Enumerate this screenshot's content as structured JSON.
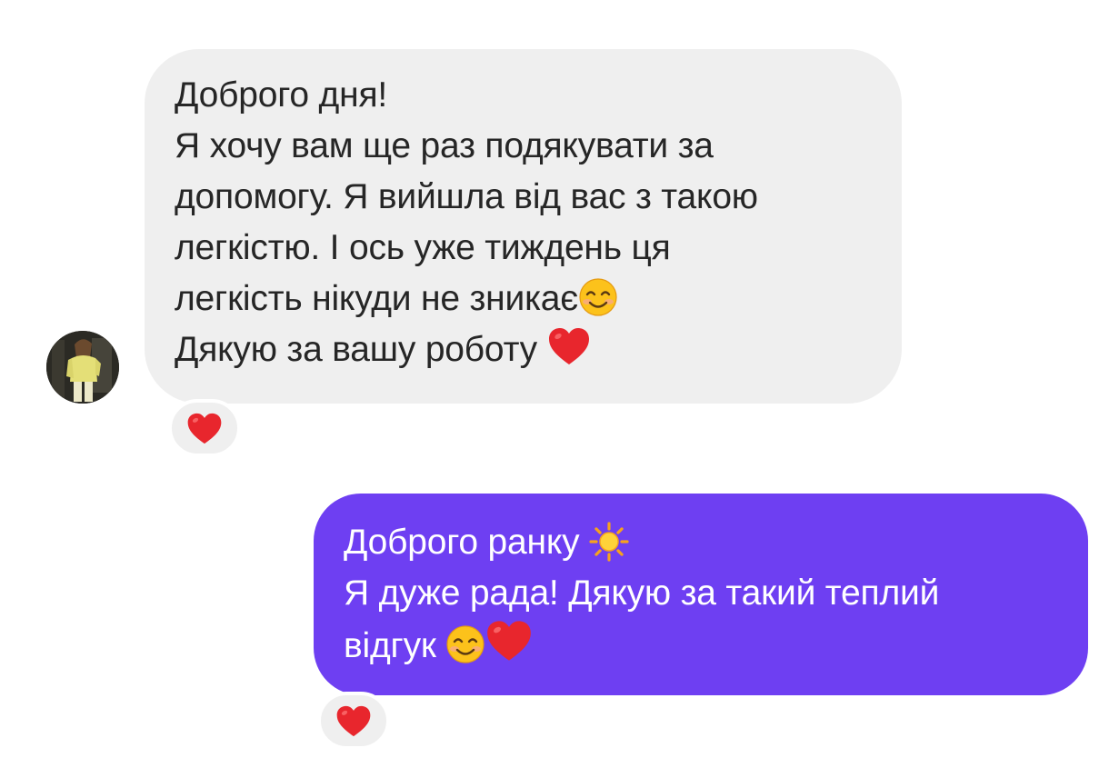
{
  "conversation": {
    "incoming_message": {
      "lines": [
        "Доброго дня!",
        "Я хочу вам ще раз подякувати за",
        "допомогу. Я вийшла від вас з такою",
        "легкістю. І ось уже тиждень ця",
        "легкість нікуди не зникає",
        "Дякую за вашу роботу "
      ],
      "emojis": [
        "smiling-face-icon",
        "red-heart-icon"
      ],
      "reaction": "red-heart-icon"
    },
    "outgoing_message": {
      "lines": [
        "Доброго ранку ",
        "Я дуже рада! Дякую за такий теплий",
        "відгук "
      ],
      "emojis": [
        "sun-icon",
        "smiling-face-icon",
        "red-heart-icon"
      ],
      "reaction": "red-heart-icon"
    }
  },
  "colors": {
    "incoming_bubble": "#efefef",
    "outgoing_bubble": "#6e3ff2",
    "incoming_text": "#262626",
    "outgoing_text": "#ffffff",
    "heart": "#e8262d"
  }
}
